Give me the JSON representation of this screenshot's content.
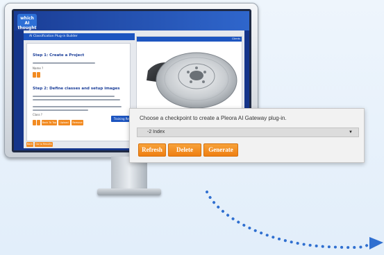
{
  "screen": {
    "logo_text": "which AI thought",
    "plugin_title": "AI Classification Plug-in Builder",
    "clients_label": "Clients",
    "step1_title": "Step 1: Create a Project",
    "step2_title": "Step 2: Define classes and setup images",
    "training_results": "Training Results",
    "small_buttons": [
      "Back To Top",
      "Upload",
      "Remove"
    ],
    "bottom_buttons": [
      "Back",
      "Go to Results"
    ]
  },
  "popup": {
    "instruction": "Choose a checkpoint to create a Pleora AI Gateway plug-in.",
    "select_value": "-2 Index",
    "buttons": {
      "refresh": "Refresh",
      "delete": "Delete",
      "generate": "Generate"
    }
  },
  "colors": {
    "accent_orange": "#F28B22",
    "brand_blue": "#1D55C0",
    "arrow_blue": "#2F6FD0"
  }
}
